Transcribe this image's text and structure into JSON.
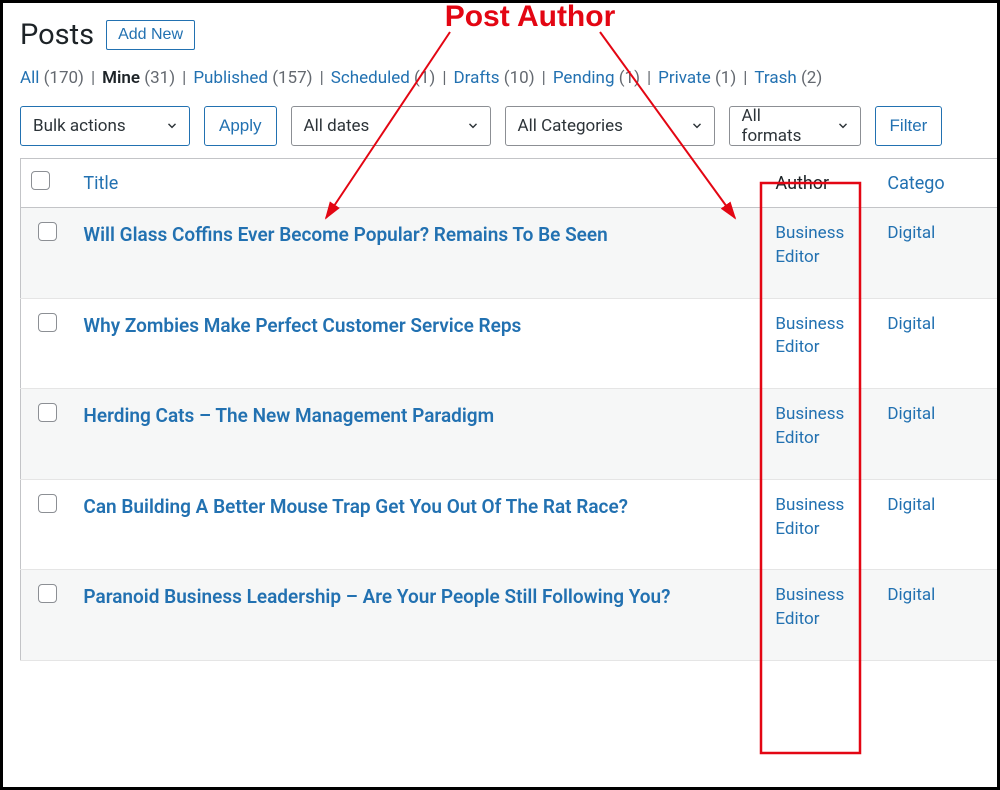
{
  "annotation": {
    "label": "Post Author"
  },
  "header": {
    "title": "Posts",
    "add_new": "Add New"
  },
  "filters": [
    {
      "label": "All",
      "count": "170",
      "current": false
    },
    {
      "label": "Mine",
      "count": "31",
      "current": true
    },
    {
      "label": "Published",
      "count": "157",
      "current": false
    },
    {
      "label": "Scheduled",
      "count": "1",
      "current": false
    },
    {
      "label": "Drafts",
      "count": "10",
      "current": false
    },
    {
      "label": "Pending",
      "count": "1",
      "current": false
    },
    {
      "label": "Private",
      "count": "1",
      "current": false
    },
    {
      "label": "Trash",
      "count": "2",
      "current": false
    }
  ],
  "toolbar": {
    "bulk_actions": "Bulk actions",
    "apply": "Apply",
    "dates": "All dates",
    "categories": "All Categories",
    "formats": "All formats",
    "filter": "Filter"
  },
  "columns": {
    "title": "Title",
    "author": "Author",
    "categories": "Catego"
  },
  "rows": [
    {
      "title": "Will Glass Coffins Ever Become Popular? Remains To Be Seen",
      "author": "Business Editor",
      "category": "Digital "
    },
    {
      "title": "Why Zombies Make Perfect Customer Service Reps",
      "author": "Business Editor",
      "category": "Digital "
    },
    {
      "title": "Herding Cats – The New Management Paradigm",
      "author": "Business Editor",
      "category": "Digital "
    },
    {
      "title": "Can Building A Better Mouse Trap Get You Out Of The Rat Race?",
      "author": "Business Editor",
      "category": "Digital "
    },
    {
      "title": "Paranoid Business Leadership – Are Your People Still Following You?",
      "author": "Business Editor",
      "category": "Digital "
    }
  ]
}
